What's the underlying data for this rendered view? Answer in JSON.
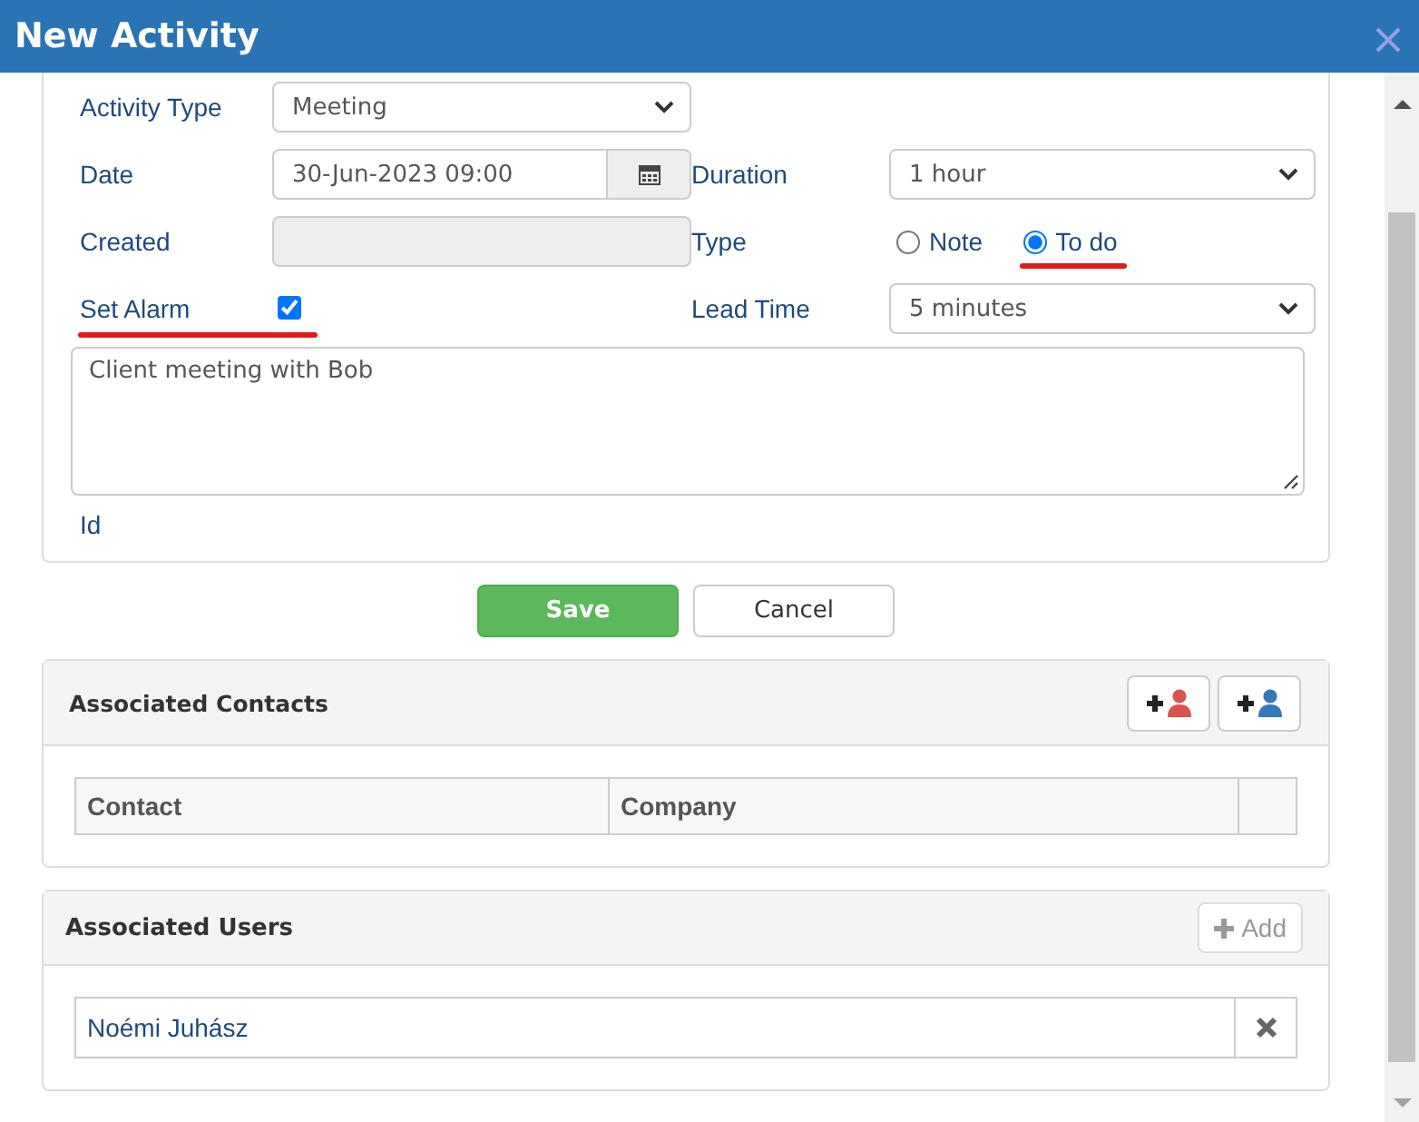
{
  "window": {
    "title": "New Activity"
  },
  "form": {
    "rows": [
      [
        {
          "kind": "select",
          "label": "Activity Type",
          "value": "Meeting"
        }
      ],
      [
        {
          "kind": "date",
          "label": "Date",
          "value": "30-Jun-2023 09:00"
        },
        {
          "kind": "select",
          "label": "Duration",
          "value": "1 hour"
        }
      ],
      [
        {
          "kind": "text",
          "label": "Created",
          "disabled": true
        },
        {
          "kind": "radio",
          "label": "Type",
          "options": [
            {
              "label": "Note",
              "selected": false,
              "highlighted": false
            },
            {
              "label": "To do",
              "selected": true,
              "highlighted": true
            }
          ]
        }
      ],
      [
        {
          "kind": "checkbox",
          "label": "Set Alarm",
          "checked": true,
          "highlighted": true
        },
        {
          "kind": "select",
          "label": "Lead Time",
          "value": "5 minutes"
        }
      ]
    ],
    "notes": "Client meeting with Bob",
    "id_label": "Id"
  },
  "buttons": [
    {
      "label": "Save",
      "kind": "primary"
    },
    {
      "label": "Cancel",
      "kind": "default"
    }
  ],
  "contacts": {
    "title": "Associated Contacts",
    "columns": [
      "Contact",
      "Company"
    ],
    "actions": [
      {
        "color": "#d9534f"
      },
      {
        "color": "#337ab7"
      }
    ]
  },
  "users": {
    "title": "Associated Users",
    "add_button": {
      "label": "Add",
      "disabled": true
    },
    "rows": [
      {
        "name": "Noémi Juhász"
      }
    ]
  }
}
